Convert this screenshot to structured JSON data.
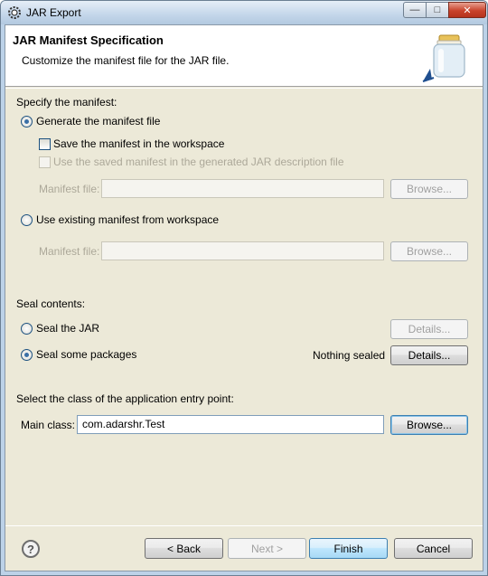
{
  "window": {
    "title": "JAR Export",
    "controls": {
      "minimize": "—",
      "maximize": "□",
      "close": "✕"
    }
  },
  "banner": {
    "title": "JAR Manifest Specification",
    "description": "Customize the manifest file for the JAR file."
  },
  "manifest": {
    "heading": "Specify the manifest:",
    "generate_label": "Generate the manifest file",
    "generate_checked": true,
    "save_label": "Save the manifest in the workspace",
    "save_checked": false,
    "reuse_label": "Use the saved manifest in the generated JAR description file",
    "reuse_enabled": false,
    "manifest_file_label": "Manifest file:",
    "manifest_file_value": "",
    "browse_label": "Browse...",
    "existing_label": "Use existing manifest from workspace",
    "existing_checked": false,
    "existing_manifest_file_label": "Manifest file:",
    "existing_manifest_file_value": "",
    "existing_browse_label": "Browse..."
  },
  "seal": {
    "heading": "Seal contents:",
    "seal_jar_label": "Seal the JAR",
    "seal_jar_checked": false,
    "seal_jar_details_label": "Details...",
    "seal_some_label": "Seal some packages",
    "seal_some_checked": true,
    "seal_status": "Nothing sealed",
    "seal_some_details_label": "Details..."
  },
  "entry": {
    "heading": "Select the class of the application entry point:",
    "main_class_label": "Main class:",
    "main_class_value": "com.adarshr.Test",
    "browse_label": "Browse..."
  },
  "footer": {
    "help_symbol": "?",
    "back_label": "< Back",
    "next_label": "Next >",
    "finish_label": "Finish",
    "cancel_label": "Cancel"
  },
  "colors": {
    "window_frame": "#bcd2e8",
    "dialog_bg": "#ece9d8",
    "close_button": "#c9432c",
    "default_button_border": "#3c7fb1"
  },
  "icons": {
    "title_icon": "eclipse-gear-icon",
    "banner_icon": "jar-icon",
    "help_icon": "question-circle-icon"
  }
}
